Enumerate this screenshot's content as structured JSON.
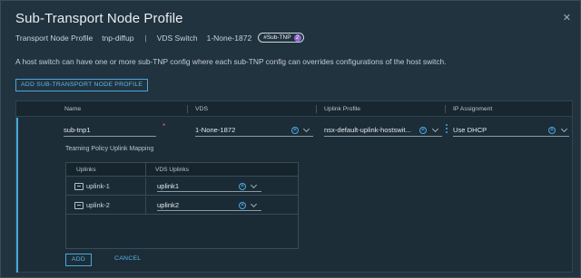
{
  "dialog": {
    "title": "Sub-Transport Node Profile",
    "close_icon": "close-icon"
  },
  "breadcrumb": {
    "item1": "Transport Node Profile",
    "item2": "tnp-diffup",
    "separator": "|",
    "item3": "VDS Switch",
    "item4": "1-None-1872",
    "pill_label": "#Sub-TNP",
    "pill_count": "2"
  },
  "description": "A host switch can have one or more sub-TNP config where each sub-TNP config can overrides configurations of the host switch.",
  "add_profile_button": "ADD SUB-TRANSPORT NODE PROFILE",
  "grid": {
    "columns": [
      "Name",
      "VDS",
      "Uplink Profile",
      "IP Assignment"
    ],
    "row": {
      "name": "sub-tnp1",
      "required_mark": "*",
      "vds": "1-None-1872",
      "uplink_profile": "nsx-default-uplink-hostswit...",
      "ip_assignment": "Use DHCP"
    }
  },
  "teaming": {
    "label": "Teaming Policy Uplink Mapping",
    "columns": [
      "Uplinks",
      "VDS Uplinks"
    ],
    "rows": [
      {
        "uplink": "uplink-1",
        "vds_uplink": "uplink1"
      },
      {
        "uplink": "uplink-2",
        "vds_uplink": "uplink2"
      }
    ]
  },
  "actions": {
    "add": "ADD",
    "cancel": "CANCEL"
  },
  "colors": {
    "accent": "#49a7d9",
    "background": "#21333f",
    "badge": "#8e6ad6"
  }
}
